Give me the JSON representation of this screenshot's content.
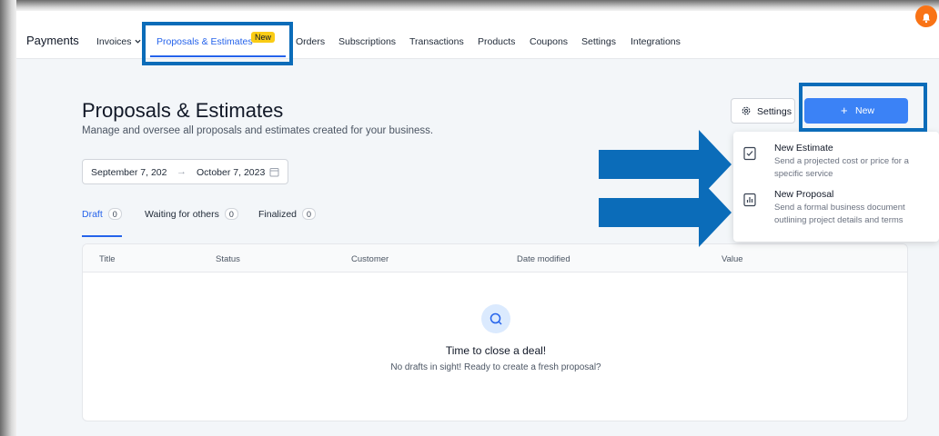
{
  "topbar": {
    "brand": "Payments",
    "nav": [
      {
        "label": "Invoices"
      },
      {
        "label": "Proposals & Estimates"
      },
      {
        "label": "Orders"
      },
      {
        "label": "Subscriptions"
      },
      {
        "label": "Transactions"
      },
      {
        "label": "Products"
      },
      {
        "label": "Coupons"
      },
      {
        "label": "Settings"
      },
      {
        "label": "Integrations"
      }
    ],
    "new_badge": "New"
  },
  "page": {
    "title": "Proposals & Estimates",
    "subtitle": "Manage and oversee all proposals and estimates created for your business.",
    "settings_label": "Settings",
    "new_label": "New",
    "new_plus": "+"
  },
  "daterange": {
    "start": "September 7, 202",
    "arrow": "→",
    "end": "October 7, 2023"
  },
  "tabs": [
    {
      "label": "Draft",
      "count": "0"
    },
    {
      "label": "Waiting for others",
      "count": "0"
    },
    {
      "label": "Finalized",
      "count": "0"
    }
  ],
  "table": {
    "columns": [
      "Title",
      "Status",
      "Customer",
      "Date modified",
      "Value"
    ],
    "empty_title": "Time to close a deal!",
    "empty_subtitle": "No drafts in sight! Ready to create a fresh proposal?"
  },
  "dropdown": {
    "items": [
      {
        "title": "New Estimate",
        "description": "Send a projected cost or price for a specific service"
      },
      {
        "title": "New Proposal",
        "description": "Send a formal business document outlining project details and terms"
      }
    ]
  },
  "colors": {
    "accent": "#3b82f6",
    "highlight": "#0b6cb9",
    "badge": "#facc15",
    "avatar": "#f97316"
  },
  "icons": {
    "settings": "gear-icon",
    "calendar": "calendar-icon",
    "search": "search-icon",
    "estimate": "estimate-doc-icon",
    "proposal": "chart-doc-icon",
    "notification": "bell-icon"
  }
}
